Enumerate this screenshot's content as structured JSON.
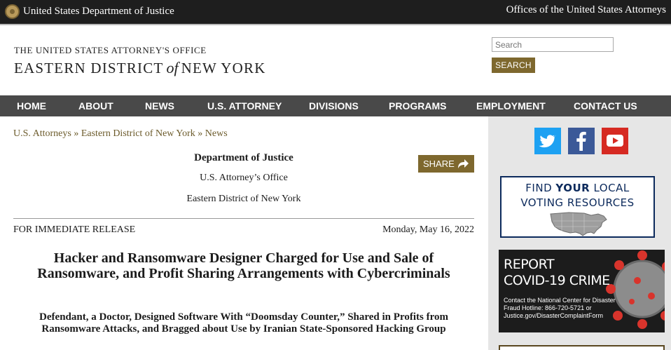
{
  "topbar": {
    "agency": "United States Department of Justice",
    "offices_link": "Offices of the United States Attorneys"
  },
  "masthead": {
    "office_line": "THE UNITED STATES ATTORNEY'S OFFICE",
    "district_part1": "EASTERN DISTRICT",
    "district_of": "of",
    "district_part2": "NEW YORK",
    "search_placeholder": "Search",
    "search_button": "SEARCH"
  },
  "nav": {
    "items": [
      "HOME",
      "ABOUT",
      "NEWS",
      "U.S. ATTORNEY",
      "DIVISIONS",
      "PROGRAMS",
      "EMPLOYMENT",
      "CONTACT US"
    ]
  },
  "breadcrumb": {
    "items": [
      "U.S. Attorneys",
      "Eastern District of New York",
      "News"
    ],
    "separator": "»"
  },
  "press": {
    "department": "Department of Justice",
    "office": "U.S. Attorney’s Office",
    "district": "Eastern District of New York",
    "share_label": "SHARE",
    "release_label": "FOR IMMEDIATE RELEASE",
    "date": "Monday, May 16, 2022",
    "headline": "Hacker and Ransomware Designer Charged for Use and Sale of Ransomware, and Profit Sharing Arrangements with Cybercriminals",
    "subheadline": "Defendant, a Doctor, Designed Software With “Doomsday Counter,” Shared in Profits from Ransomware Attacks, and Bragged about Use by Iranian State-Sponsored Hacking Group"
  },
  "sidebar": {
    "social": [
      "twitter-icon",
      "facebook-icon",
      "youtube-icon"
    ],
    "voting_line1_a": "FIND ",
    "voting_line1_b": "YOUR",
    "voting_line1_c": " LOCAL",
    "voting_line2": "VOTING RESOURCES",
    "covid_title1": "REPORT",
    "covid_title2": "COVID-19 CRIME",
    "covid_sub": "Contact the National Center for Disaster Fraud Hotline: 866-720-5721 or Justice.gov/DisasterComplaintForm"
  },
  "colors": {
    "topbar": "#1e1e1e",
    "nav": "#494949",
    "accent_gold": "#7e682e",
    "sidebar_bg": "#e6e6e6",
    "voting_navy": "#0c2a5c"
  }
}
